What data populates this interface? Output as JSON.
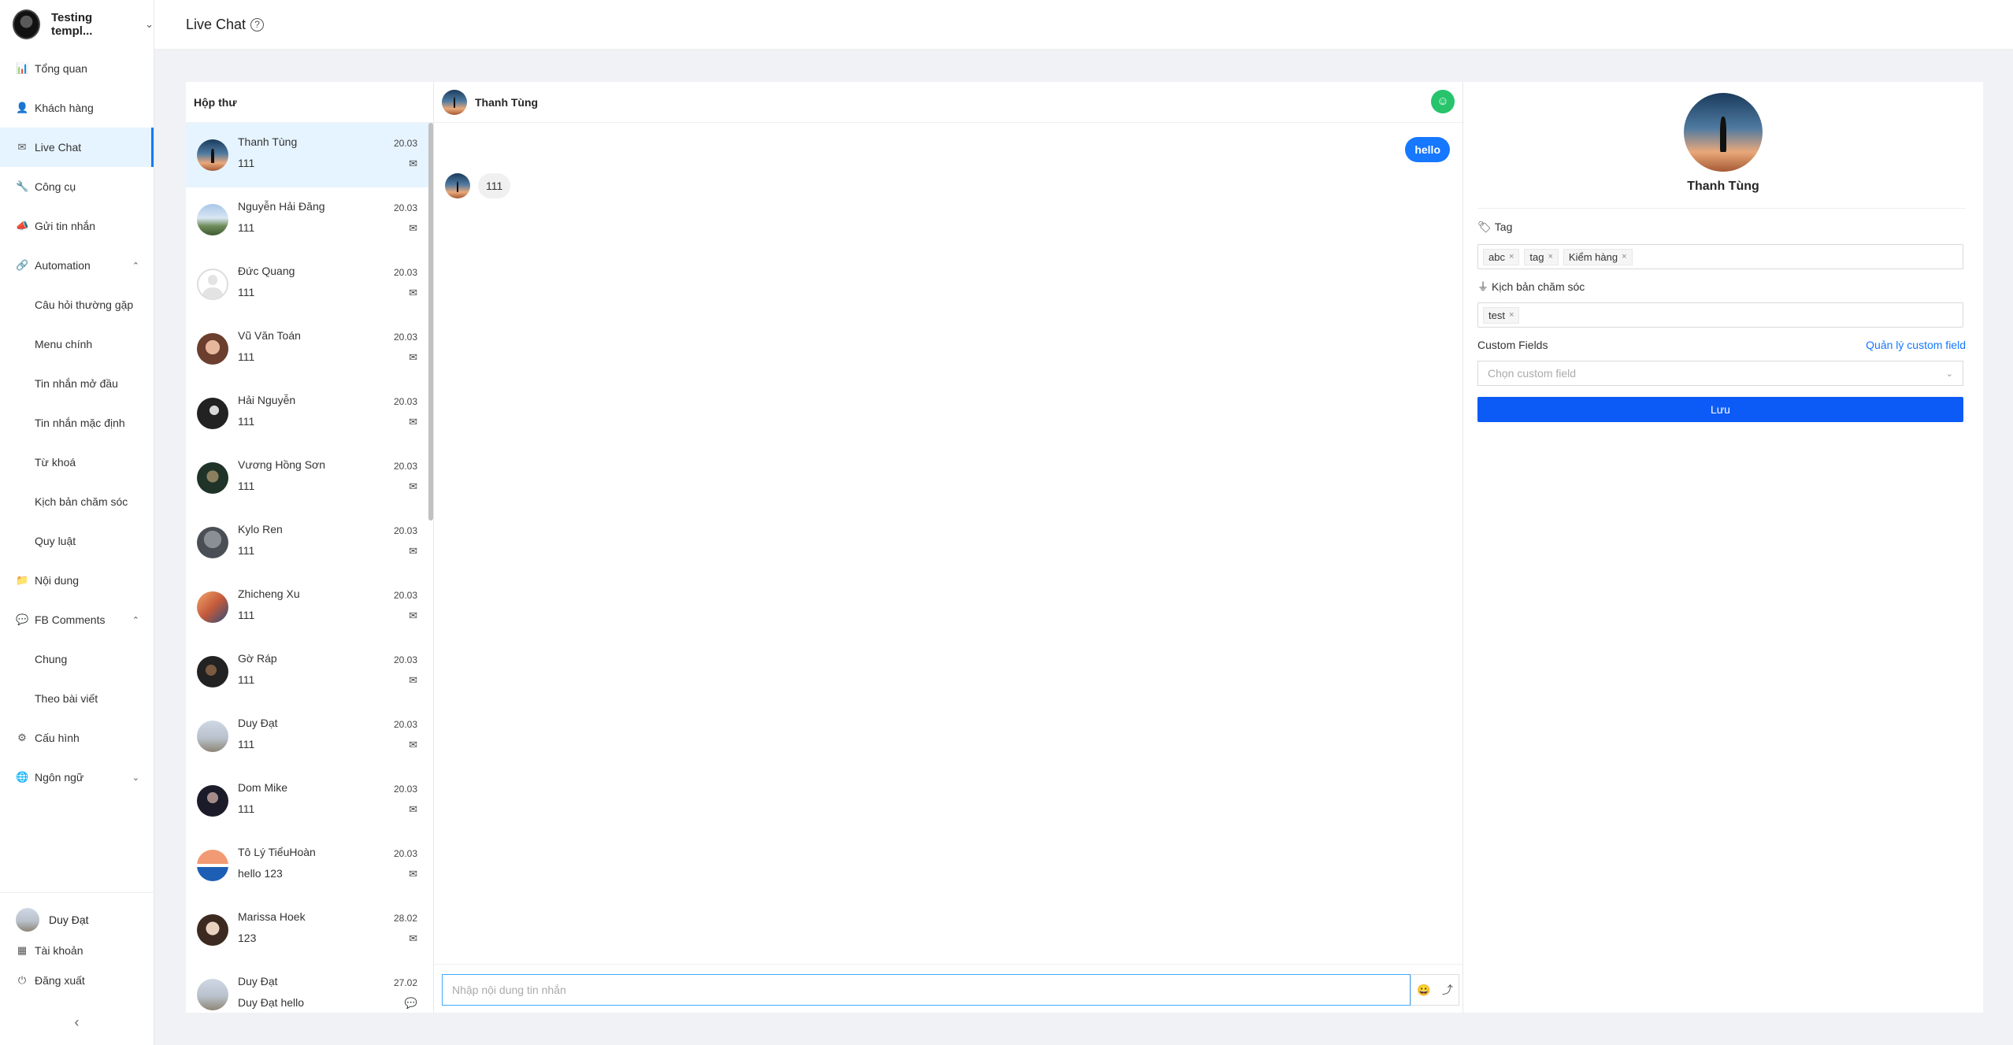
{
  "brand": {
    "name": "Testing templ...",
    "caret": "⌄"
  },
  "header": {
    "title": "Live Chat",
    "help": "?"
  },
  "sidebar": {
    "items": [
      {
        "label": "Tổng quan",
        "icon": "📊"
      },
      {
        "label": "Khách hàng",
        "icon": "👤"
      },
      {
        "label": "Live Chat",
        "icon": "✉"
      },
      {
        "label": "Công cụ",
        "icon": "🔧"
      },
      {
        "label": "Gửi tin nhắn",
        "icon": "📣"
      },
      {
        "label": "Automation",
        "icon": "🔗",
        "caret": "⌃"
      },
      {
        "label": "Câu hỏi thường gặp"
      },
      {
        "label": "Menu chính"
      },
      {
        "label": "Tin nhắn mở đầu"
      },
      {
        "label": "Tin nhắn mặc định"
      },
      {
        "label": "Từ khoá"
      },
      {
        "label": "Kịch bản chăm sóc"
      },
      {
        "label": "Quy luật"
      },
      {
        "label": "Nội dung",
        "icon": "📁"
      },
      {
        "label": "FB Comments",
        "icon": "💬",
        "caret": "⌃"
      },
      {
        "label": "Chung"
      },
      {
        "label": "Theo bài viết"
      },
      {
        "label": "Cấu hình",
        "icon": "⚙"
      },
      {
        "label": "Ngôn ngữ",
        "icon": "🌐",
        "caret": "⌄"
      }
    ],
    "bottom": {
      "user": "Duy Đạt",
      "account": {
        "label": "Tài khoản",
        "icon": "▦"
      },
      "logout": {
        "label": "Đăng xuất",
        "icon": "⏻"
      },
      "collapse": "‹"
    }
  },
  "inbox": {
    "title": "Hộp thư",
    "conversations": [
      {
        "name": "Thanh Tùng",
        "message": "111",
        "time": "20.03",
        "icon": "✉"
      },
      {
        "name": "Nguyễn Hải Đăng",
        "message": "111",
        "time": "20.03",
        "icon": "✉"
      },
      {
        "name": "Đức Quang",
        "message": "111",
        "time": "20.03",
        "icon": "✉"
      },
      {
        "name": "Vũ Văn Toán",
        "message": "111",
        "time": "20.03",
        "icon": "✉"
      },
      {
        "name": "Hải Nguyễn",
        "message": "111",
        "time": "20.03",
        "icon": "✉"
      },
      {
        "name": "Vương Hồng Sơn",
        "message": "111",
        "time": "20.03",
        "icon": "✉"
      },
      {
        "name": "Kylo Ren",
        "message": "111",
        "time": "20.03",
        "icon": "✉"
      },
      {
        "name": "Zhicheng Xu",
        "message": "111",
        "time": "20.03",
        "icon": "✉"
      },
      {
        "name": "Gờ Ráp",
        "message": "111",
        "time": "20.03",
        "icon": "✉"
      },
      {
        "name": "Duy Đạt",
        "message": "111",
        "time": "20.03",
        "icon": "✉"
      },
      {
        "name": "Dom Mike",
        "message": "111",
        "time": "20.03",
        "icon": "✉"
      },
      {
        "name": "Tô Lý TiểuHoàn",
        "message": "hello 123",
        "time": "20.03",
        "icon": "✉"
      },
      {
        "name": "Marissa Hoek",
        "message": "123",
        "time": "28.02",
        "icon": "✉"
      },
      {
        "name": "Duy Đạt",
        "message": "Duy Đạt hello",
        "time": "27.02",
        "icon": "💬"
      }
    ]
  },
  "chat": {
    "contact_name": "Thanh Tùng",
    "messages": {
      "outgoing": "hello",
      "incoming": "111"
    },
    "composer_placeholder": "Nhập nội dung tin nhắn",
    "emoji_icon": "😀",
    "share_icon": "⤴",
    "channel_icon": "☺"
  },
  "profile": {
    "name": "Thanh Tùng",
    "tag_label": "Tag",
    "tags": [
      "abc",
      "tag",
      "Kiểm hàng"
    ],
    "script_label": "Kịch bản chăm sóc",
    "scripts": [
      "test"
    ],
    "custom_fields_label": "Custom Fields",
    "manage_link": "Quản lý custom field",
    "custom_field_placeholder": "Chọn custom field",
    "save_label": "Lưu",
    "remove_glyph": "×"
  }
}
